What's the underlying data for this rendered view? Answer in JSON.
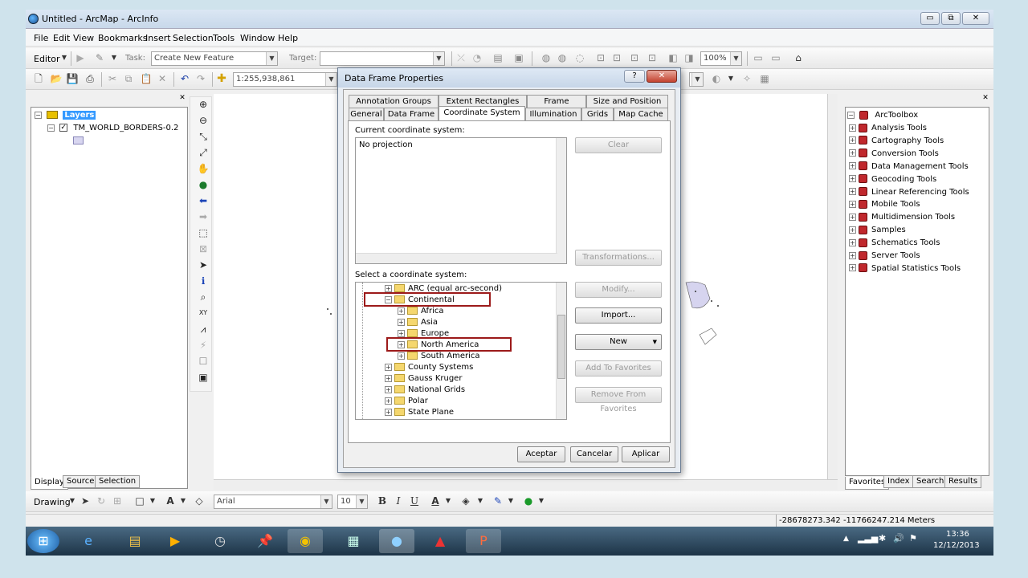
{
  "window": {
    "title": "Untitled - ArcMap - ArcInfo",
    "min_label": "▭",
    "max_label": "⧉",
    "close_label": "✕"
  },
  "menu": [
    "File",
    "Edit",
    "View",
    "Bookmarks",
    "Insert",
    "Selection",
    "Tools",
    "Window",
    "Help"
  ],
  "editor_toolbar": {
    "editor_label": "Editor",
    "task_label": "Task:",
    "task_value": "Create New Feature",
    "target_label": "Target:",
    "zoom_value": "100%"
  },
  "standard_toolbar": {
    "scale_value": "1:255,938,861"
  },
  "toc": {
    "layers_label": "Layers",
    "layer_name": "TM_WORLD_BORDERS-0.2",
    "tabs": [
      "Display",
      "Source",
      "Selection"
    ]
  },
  "toolbox": {
    "root": "ArcToolbox",
    "items": [
      "Analysis Tools",
      "Cartography Tools",
      "Conversion Tools",
      "Data Management Tools",
      "Geocoding Tools",
      "Linear Referencing Tools",
      "Mobile Tools",
      "Multidimension Tools",
      "Samples",
      "Schematics Tools",
      "Server Tools",
      "Spatial Statistics Tools"
    ],
    "tabs": [
      "Favorites",
      "Index",
      "Search",
      "Results"
    ]
  },
  "dialog": {
    "title": "Data Frame Properties",
    "help_label": "?",
    "close_label": "✕",
    "tabs_row1": [
      "Annotation Groups",
      "Extent Rectangles",
      "Frame",
      "Size and Position"
    ],
    "tabs_row2": [
      "General",
      "Data Frame",
      "Coordinate System",
      "Illumination",
      "Grids",
      "Map Cache"
    ],
    "current_cs_label": "Current coordinate system:",
    "current_cs_value": "No projection",
    "clear_button": "Clear",
    "transformations_button": "Transformations...",
    "select_cs_label": "Select a coordinate system:",
    "tree": {
      "arc": "ARC (equal arc-second)",
      "continental": "Continental",
      "africa": "Africa",
      "asia": "Asia",
      "europe": "Europe",
      "north_america": "North America",
      "south_america": "South America",
      "county": "County Systems",
      "gauss": "Gauss Kruger",
      "national": "National Grids",
      "polar": "Polar",
      "state": "State Plane"
    },
    "modify_button": "Modify...",
    "import_button": "Import...",
    "new_button": "New",
    "add_fav_button": "Add To Favorites",
    "remove_fav_button": "Remove From Favorites",
    "ok_button": "Aceptar",
    "cancel_button": "Cancelar",
    "apply_button": "Aplicar"
  },
  "drawing_toolbar": {
    "drawing_label": "Drawing",
    "font_value": "Arial",
    "size_value": "10",
    "bold": "B",
    "italic": "I",
    "underline": "U"
  },
  "status": {
    "coords": "-28678273.342  -11766247.214 Meters"
  },
  "taskbar": {
    "time": "13:36",
    "date": "12/12/2013"
  }
}
